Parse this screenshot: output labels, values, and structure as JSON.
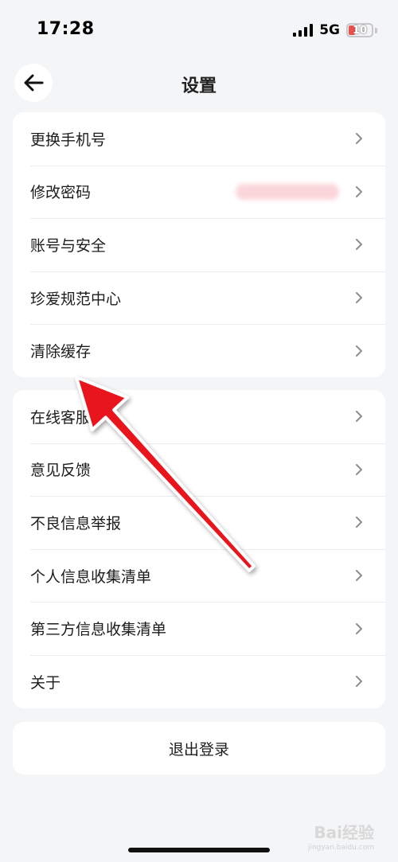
{
  "status_bar": {
    "time": "17:28",
    "network": "5G",
    "battery": "10",
    "battery_level": 0.1,
    "battery_color": "#e8524a"
  },
  "nav": {
    "back_icon": "arrow-left-icon",
    "title": "设置"
  },
  "group1": {
    "items": [
      {
        "label": "更换手机号"
      },
      {
        "label": "修改密码"
      },
      {
        "label": "账号与安全"
      },
      {
        "label": "珍爱规范中心"
      },
      {
        "label": "清除缓存"
      }
    ]
  },
  "group2": {
    "items": [
      {
        "label": "在线客服"
      },
      {
        "label": "意见反馈"
      },
      {
        "label": "不良信息举报"
      },
      {
        "label": "个人信息收集清单"
      },
      {
        "label": "第三方信息收集清单"
      },
      {
        "label": "关于"
      }
    ]
  },
  "logout": {
    "label": "退出登录"
  },
  "watermark": {
    "text": "Bai经验",
    "sub": "jingyan.baidu.com"
  },
  "colors": {
    "annotation_arrow": "#e8121b",
    "background": "#f4f5f7",
    "card": "#ffffff"
  }
}
